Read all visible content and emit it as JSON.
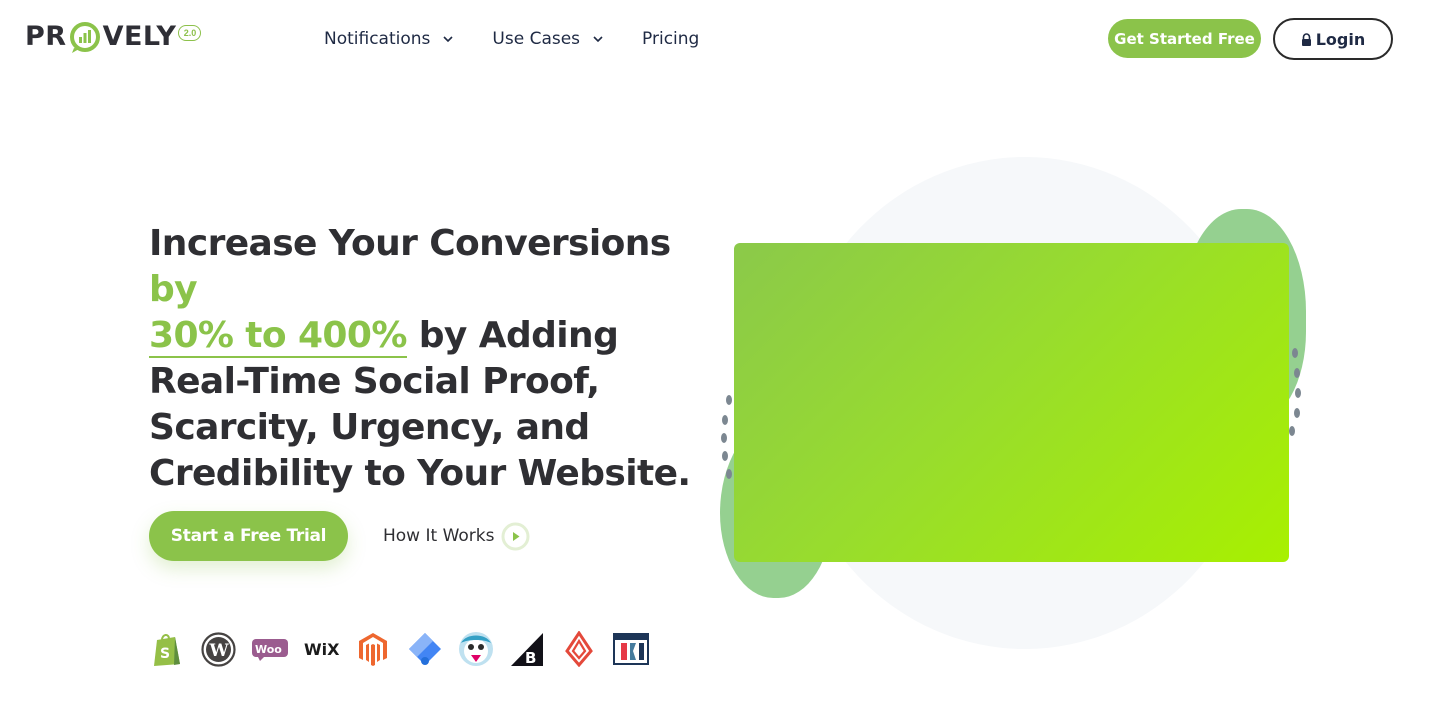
{
  "brand": {
    "name_left": "PR",
    "name_right": "VELY",
    "version_badge": "2.0",
    "accent_color": "#8bc34a",
    "text_color": "#2f2f36"
  },
  "nav": {
    "items": [
      {
        "label": "Notifications",
        "has_dropdown": true
      },
      {
        "label": "Use Cases",
        "has_dropdown": true
      },
      {
        "label": "Pricing",
        "has_dropdown": false
      }
    ]
  },
  "header_actions": {
    "get_started_label": "Get Started Free",
    "login_label": "Login",
    "login_icon": "lock-icon"
  },
  "hero": {
    "headline_part1": "Increase Your Conversions ",
    "headline_highlight1": "by",
    "headline_highlight2": "30% to 400%",
    "headline_part2": " by Adding Real-Time Social Proof, Scarcity, Urgency, and Credibility to Your Website.",
    "primary_cta": "Start a Free Trial",
    "secondary_cta": "How It Works",
    "secondary_cta_icon": "play-icon"
  },
  "integrations": [
    {
      "icon": "shopify-icon"
    },
    {
      "icon": "wordpress-icon"
    },
    {
      "icon": "woocommerce-icon",
      "text": "Woo"
    },
    {
      "icon": "wix-icon",
      "text": "WiX"
    },
    {
      "icon": "magento-icon"
    },
    {
      "icon": "google-tag-manager-icon"
    },
    {
      "icon": "prestashop-icon"
    },
    {
      "icon": "bigcommerce-icon"
    },
    {
      "icon": "lightspeed-icon"
    },
    {
      "icon": "clickfunnels-icon"
    }
  ],
  "illustration": {
    "video_placeholder_colors": [
      "#8bc94a",
      "#a8f000"
    ],
    "blob_color": "#8fce8a"
  }
}
